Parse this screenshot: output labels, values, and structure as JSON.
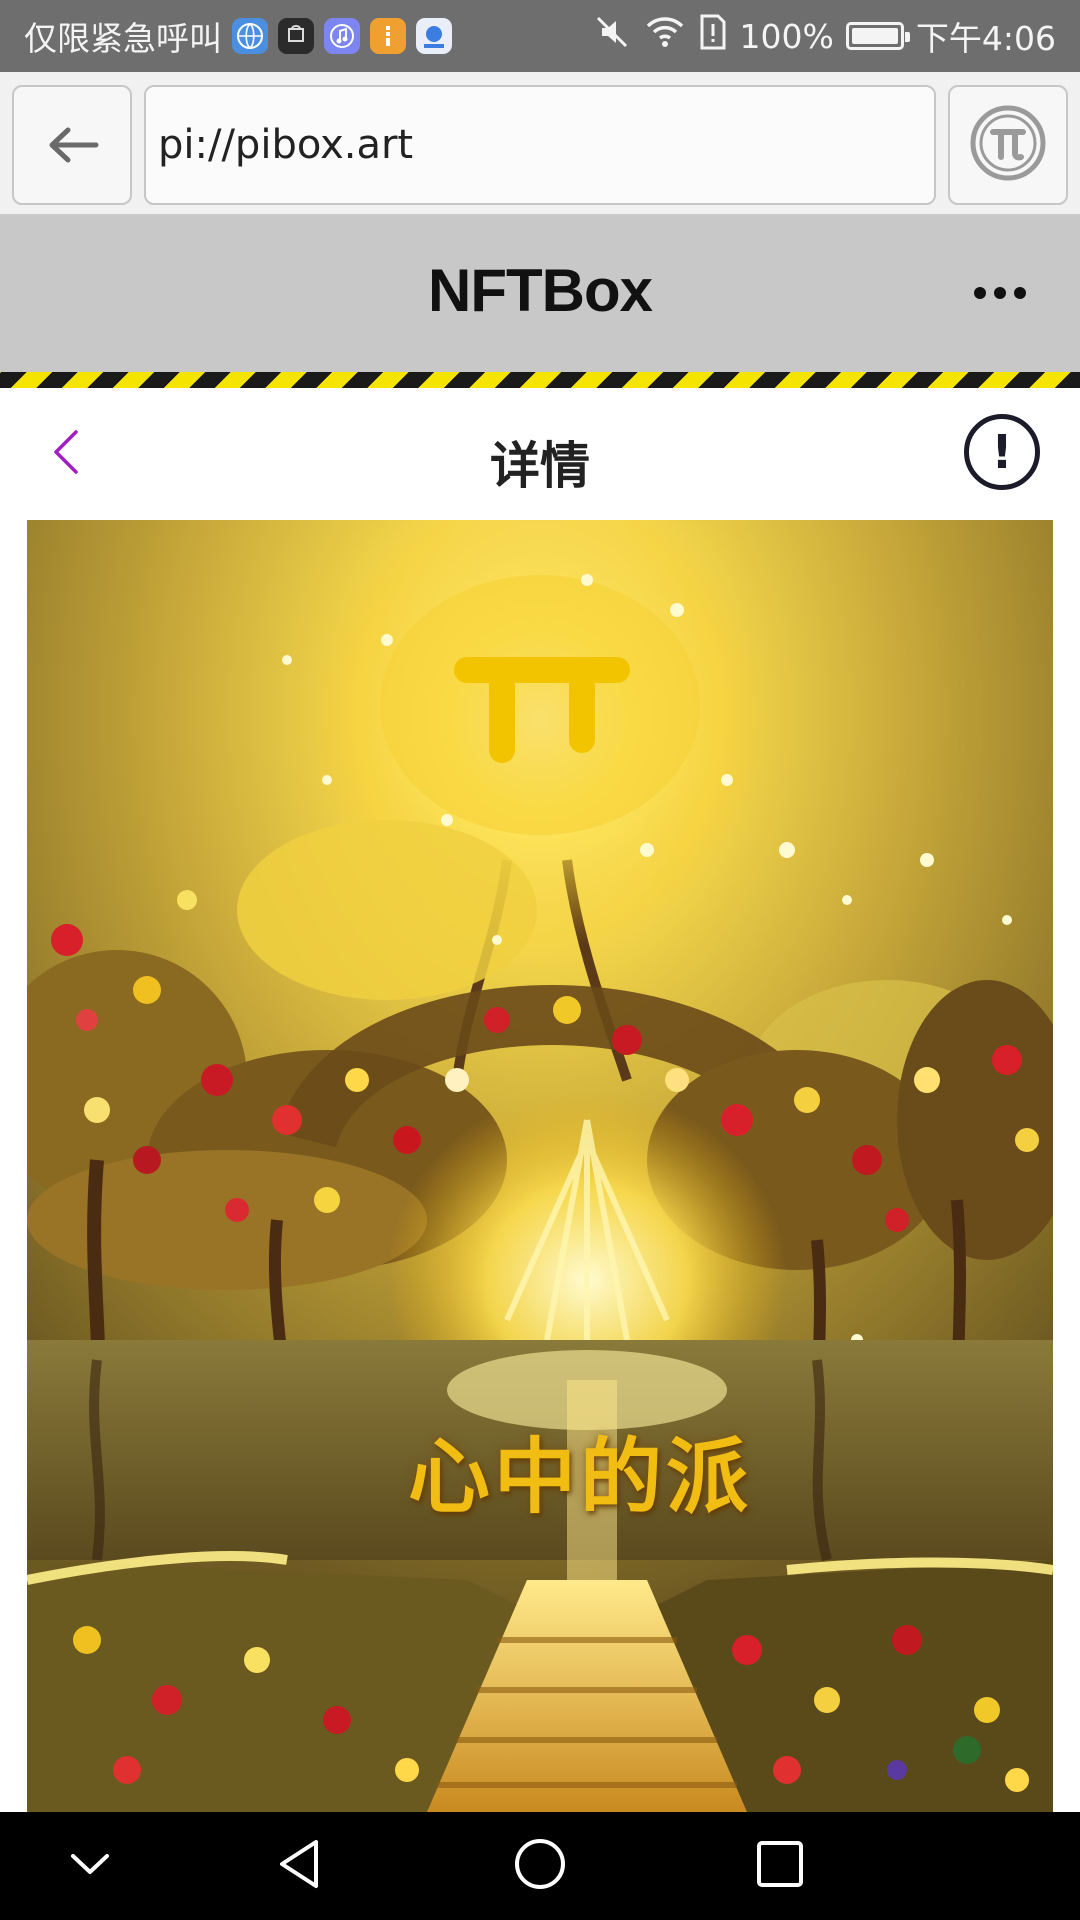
{
  "status_bar": {
    "carrier_text": "仅限紧急呼叫",
    "app_icons": [
      "globe-app-icon",
      "huawei-app-icon",
      "music-app-icon",
      "files-app-icon",
      "pi-app-icon"
    ],
    "battery_percent": "100%",
    "time": "下午4:06"
  },
  "browser": {
    "url": "pi://pibox.art",
    "back_icon": "arrow-left-icon",
    "pi_icon": "pi-coin-icon"
  },
  "app_header": {
    "title": "NFTBox",
    "more_icon": "more-dots-icon"
  },
  "page": {
    "title": "详情",
    "back_icon": "chevron-left-icon",
    "info_icon": "info-exclamation-icon"
  },
  "artwork": {
    "caption": "心中的派"
  },
  "nav_bar": {
    "buttons": [
      "collapse-icon",
      "back-triangle-icon",
      "home-circle-icon",
      "recents-square-icon"
    ]
  },
  "colors": {
    "status_bar_bg": "#6e6e6e",
    "header_bg": "#c8c8c8",
    "hazard_yellow": "#f4e400",
    "accent_purple": "#a020c0",
    "caption_gold": "#f2bd12"
  }
}
